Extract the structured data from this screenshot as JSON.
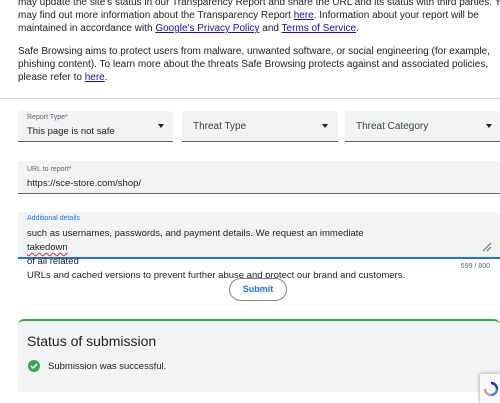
{
  "info": {
    "para1_line1": "may update the site's status in our Transparency Report and share the URL and its status with third parties. You",
    "para1_line2_pre": "may find out more information about the Transparency Report ",
    "para1_line2_link": "here",
    "para1_line2_post": ". Information about your report will be",
    "para1_line3_pre": "maintained in accordance with ",
    "para1_link_privacy": "Google's Privacy Policy",
    "para1_line3_mid": " and ",
    "para1_link_terms": "Terms of Service",
    "para1_line3_post": ".",
    "para2_line1": "Safe Browsing aims to protect users from malware, unwanted software, or social engineering (for example,",
    "para2_line2": "phishing content). To learn more about the threats Safe Browsing protects against and associated policies,",
    "para2_line3_pre": "please refer to ",
    "para2_link": "here",
    "para2_line3_post": "."
  },
  "form": {
    "report_type": {
      "label": "Report Type*",
      "value": "This page is not safe"
    },
    "threat_type": {
      "placeholder": "Threat Type"
    },
    "threat_category": {
      "placeholder": "Threat Category"
    },
    "url": {
      "label": "URL to report*",
      "value": "https://sce-store.com/shop/"
    },
    "details": {
      "label": "Additional details",
      "line1_pre": "such as usernames, passwords, and payment details. We request an immediate ",
      "line1_misspelled": "takedown",
      "line1_post": " of all related",
      "line2": "URLs and cached versions to prevent further abuse and protect our brand and customers.",
      "counter": "599 / 800"
    },
    "submit_label": "Submit"
  },
  "status": {
    "title": "Status of submission",
    "message": "Submission was successful.",
    "icon": "check-circle-icon",
    "color": "#34a853"
  },
  "colors": {
    "link": "#1a0dab",
    "accent": "#1a73e8",
    "field_bg": "#f1f3f4"
  }
}
